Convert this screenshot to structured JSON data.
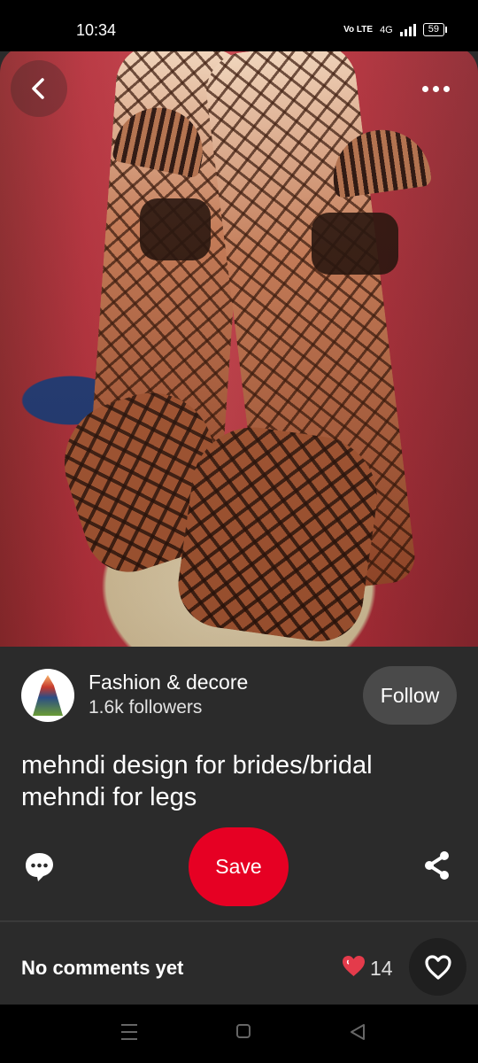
{
  "status_bar": {
    "time": "10:34",
    "volte": "Vo LTE",
    "network": "4G",
    "battery": "59"
  },
  "pin": {
    "back_icon": "chevron-left-icon",
    "more_icon": "more-horizontal-icon"
  },
  "creator": {
    "name": "Fashion & decore",
    "followers": "1.6k followers",
    "follow_label": "Follow"
  },
  "title": "mehndi design for brides/bridal mehndi for legs",
  "actions": {
    "comment_icon": "comment-icon",
    "save_label": "Save",
    "share_icon": "share-icon"
  },
  "comments": {
    "label": "No comments yet",
    "reaction_count": "14",
    "reaction_icon": "heart-reaction-icon",
    "like_icon": "heart-outline-icon"
  },
  "navigation": {
    "menu_icon": "menu-icon",
    "home_icon": "square-icon",
    "back_icon": "triangle-back-icon"
  },
  "colors": {
    "background": "#2b2b2b",
    "save": "#e60023",
    "follow": "#4a4a4a",
    "reaction": "#e43b4b"
  }
}
